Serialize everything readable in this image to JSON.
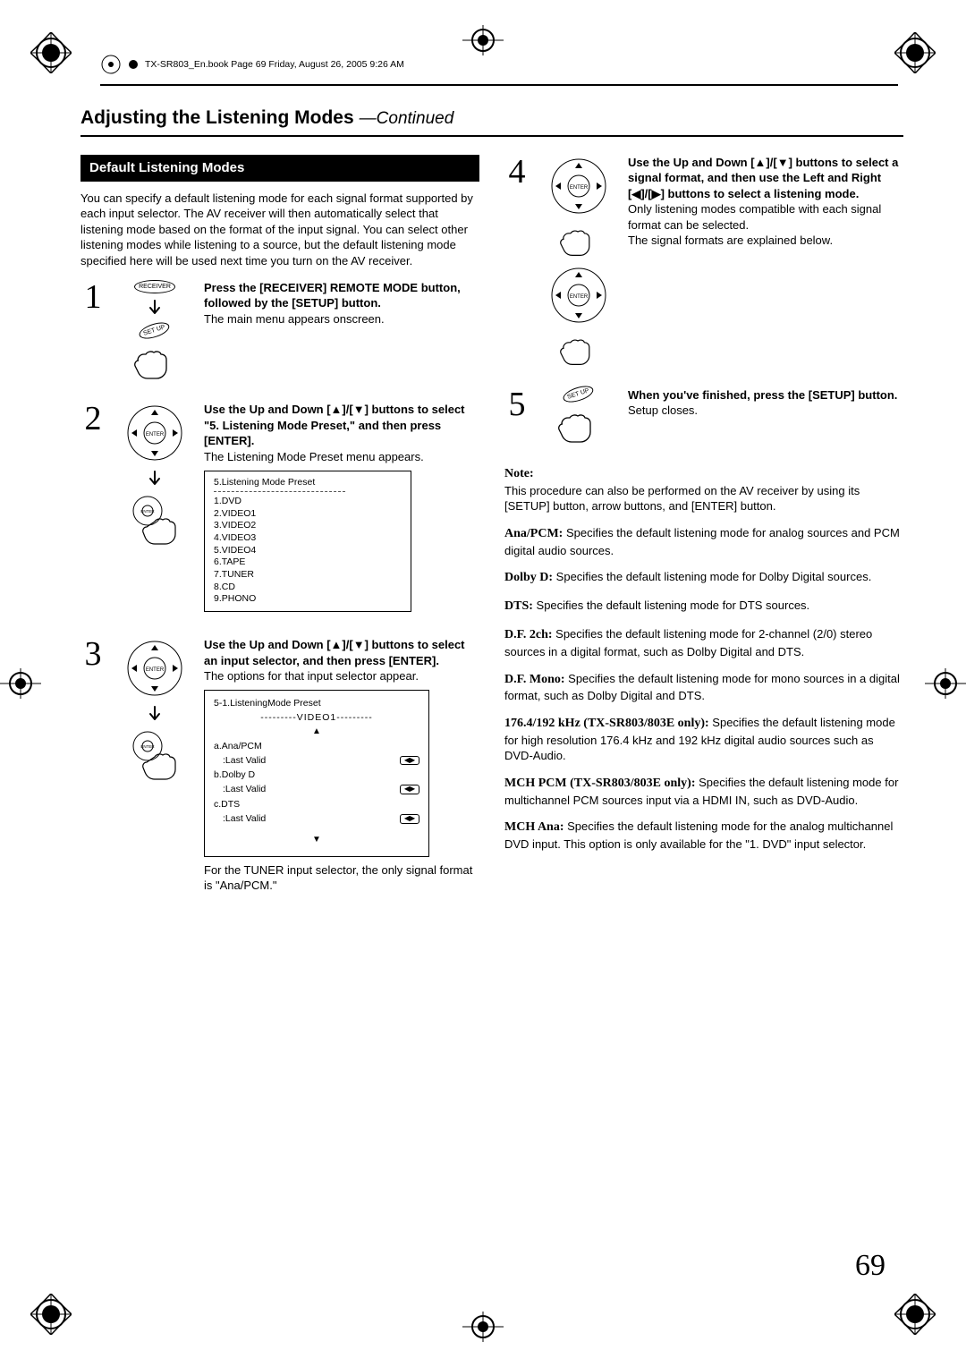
{
  "book_header": "TX-SR803_En.book  Page 69  Friday, August 26, 2005  9:26 AM",
  "title": {
    "main": "Adjusting the Listening Modes",
    "cont": "—Continued"
  },
  "section": "Default Listening Modes",
  "intro": "You can specify a default listening mode for each signal format supported by each input selector. The AV receiver will then automatically select that listening mode based on the format of the input signal. You can select other listening modes while listening to a source, but the default listening mode speciﬁed here will be used next time you turn on the AV receiver.",
  "steps": {
    "s1": {
      "num": "1",
      "head": "Press the [RECEIVER] REMOTE MODE button, followed by the [SETUP] button.",
      "body": "The main menu appears onscreen.",
      "btn_receiver": "RECEIVER",
      "btn_setup": "SET UP"
    },
    "s2": {
      "num": "2",
      "head": "Use the Up and Down [▲]/[▼] buttons to select \"5. Listening Mode Preset,\" and then press [ENTER].",
      "body": "The Listening Mode Preset menu appears.",
      "menu_title": "5.Listening Mode Preset",
      "menu_items": [
        "1.DVD",
        "2.VIDEO1",
        "3.VIDEO2",
        "4.VIDEO3",
        "5.VIDEO4",
        "6.TAPE",
        "7.TUNER",
        "8.CD",
        "9.PHONO"
      ]
    },
    "s3": {
      "num": "3",
      "head": "Use the Up and Down [▲]/[▼] buttons to select an input selector, and then press [ENTER].",
      "body": "The options for that input selector appear.",
      "menu_title": "5-1.ListeningMode Preset",
      "menu_sub": "---------VIDEO1---------",
      "rows": [
        {
          "k": "a.Ana/PCM",
          "v": ":Last Valid"
        },
        {
          "k": "b.Dolby D",
          "v": ":Last Valid"
        },
        {
          "k": "c.DTS",
          "v": ":Last Valid"
        }
      ],
      "body2": "For the TUNER input selector, the only signal format is \"Ana/PCM.\""
    },
    "s4": {
      "num": "4",
      "head": "Use the Up and Down [▲]/[▼] buttons to select a signal format, and then use the Left and Right [◀]/[▶] buttons to select a listening mode.",
      "body": "Only listening modes compatible with each signal format can be selected.\nThe signal formats are explained below."
    },
    "s5": {
      "num": "5",
      "head": "When you've finished, press the [SETUP] button.",
      "body": "Setup closes.",
      "btn_setup": "SET UP"
    }
  },
  "note": {
    "head": "Note:",
    "body": "This procedure can also be performed on the AV receiver by using its [SETUP] button, arrow buttons, and [ENTER] button."
  },
  "defs": {
    "ana": {
      "k": "Ana/PCM:",
      "v": " Speciﬁes the default listening mode for analog sources and PCM digital audio sources."
    },
    "dolby": {
      "k": "Dolby D:",
      "v": " Speciﬁes the default listening mode for Dolby Digital sources."
    },
    "dts": {
      "k": "DTS:",
      "v": " Speciﬁes the default listening mode for DTS sources."
    },
    "df2": {
      "k": "D.F. 2ch:",
      "v": " Speciﬁes the default listening mode for 2-channel (2/0) stereo sources in a digital format, such as Dolby Digital and DTS."
    },
    "dfm": {
      "k": "D.F. Mono:",
      "v": " Speciﬁes the default listening mode for mono sources in a digital format, such as Dolby Digital and DTS."
    },
    "hz": {
      "k": "176.4/192 kHz (TX-SR803/803E only):",
      "v": " Speciﬁes the default listening mode for high resolution 176.4 kHz and 192 kHz digital audio sources such as DVD-Audio."
    },
    "mchpcm": {
      "k": "MCH PCM (TX-SR803/803E only):",
      "v": " Speciﬁes the default listening mode for multichannel PCM sources input via a HDMI IN, such as DVD-Audio."
    },
    "mchana": {
      "k": "MCH Ana:",
      "v": " Speciﬁes the default listening mode for the analog multichannel DVD input. This option is only available for the \"1. DVD\" input selector."
    }
  },
  "page_number": "69",
  "icons": {
    "enter": "ENTER"
  }
}
